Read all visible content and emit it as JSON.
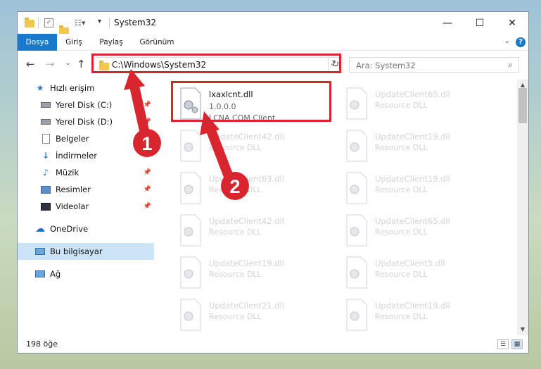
{
  "window": {
    "title": "System32",
    "controls": {
      "minimize": "—",
      "maximize": "☐",
      "close": "✕"
    }
  },
  "ribbon": {
    "tabs": [
      {
        "label": "Dosya",
        "active": true
      },
      {
        "label": "Giriş"
      },
      {
        "label": "Paylaş"
      },
      {
        "label": "Görünüm"
      }
    ],
    "help": "?"
  },
  "address": {
    "path": "C:\\Windows\\System32",
    "search_placeholder": "Ara: System32"
  },
  "sidebar": {
    "items": [
      {
        "label": "Hızlı erişim",
        "icon": "star-icon"
      },
      {
        "label": "Yerel Disk (C:)",
        "icon": "drive-icon",
        "pinned": true
      },
      {
        "label": "Yerel Disk (D:)",
        "icon": "drive-icon",
        "pinned": true
      },
      {
        "label": "Belgeler",
        "icon": "documents-icon",
        "pinned": true
      },
      {
        "label": "İndirmeler",
        "icon": "download-icon",
        "pinned": true
      },
      {
        "label": "Müzik",
        "icon": "music-icon",
        "pinned": true
      },
      {
        "label": "Resimler",
        "icon": "pictures-icon",
        "pinned": true
      },
      {
        "label": "Videolar",
        "icon": "video-icon",
        "pinned": true
      },
      {
        "label": "OneDrive",
        "icon": "cloud-icon"
      },
      {
        "label": "Bu bilgisayar",
        "icon": "computer-icon",
        "selected": true
      },
      {
        "label": "Ağ",
        "icon": "network-icon"
      }
    ]
  },
  "files": [
    {
      "name": "lxaxlcnt.dll",
      "version": "1.0.0.0",
      "description": "LCNA COM Client",
      "highlighted": true
    },
    {
      "name": "UpdateClient65.dll",
      "description": "Resource DLL"
    },
    {
      "name": "UpdateClient42.dll",
      "description": "Resource DLL"
    },
    {
      "name": "UpdateClient19.dll",
      "description": "Resource DLL"
    },
    {
      "name": "UpdateClient63.dll",
      "description": "Resource DLL"
    },
    {
      "name": "UpdateClient19.dll",
      "description": "Resource DLL"
    },
    {
      "name": "UpdateClient42.dll",
      "description": "Resource DLL"
    },
    {
      "name": "UpdateClient65.dll",
      "description": "Resource DLL"
    },
    {
      "name": "UpdateClient19.dll",
      "description": "Resource DLL"
    },
    {
      "name": "UpdateClient5.dll",
      "description": "Resource DLL"
    },
    {
      "name": "UpdateClient21.dll",
      "description": "Resource DLL"
    },
    {
      "name": "UpdateClient19.dll",
      "description": "Resource DLL"
    }
  ],
  "status": {
    "count": "198 öğe"
  },
  "annotations": {
    "marker_1": "1",
    "marker_2": "2",
    "color": "#d9262e"
  }
}
